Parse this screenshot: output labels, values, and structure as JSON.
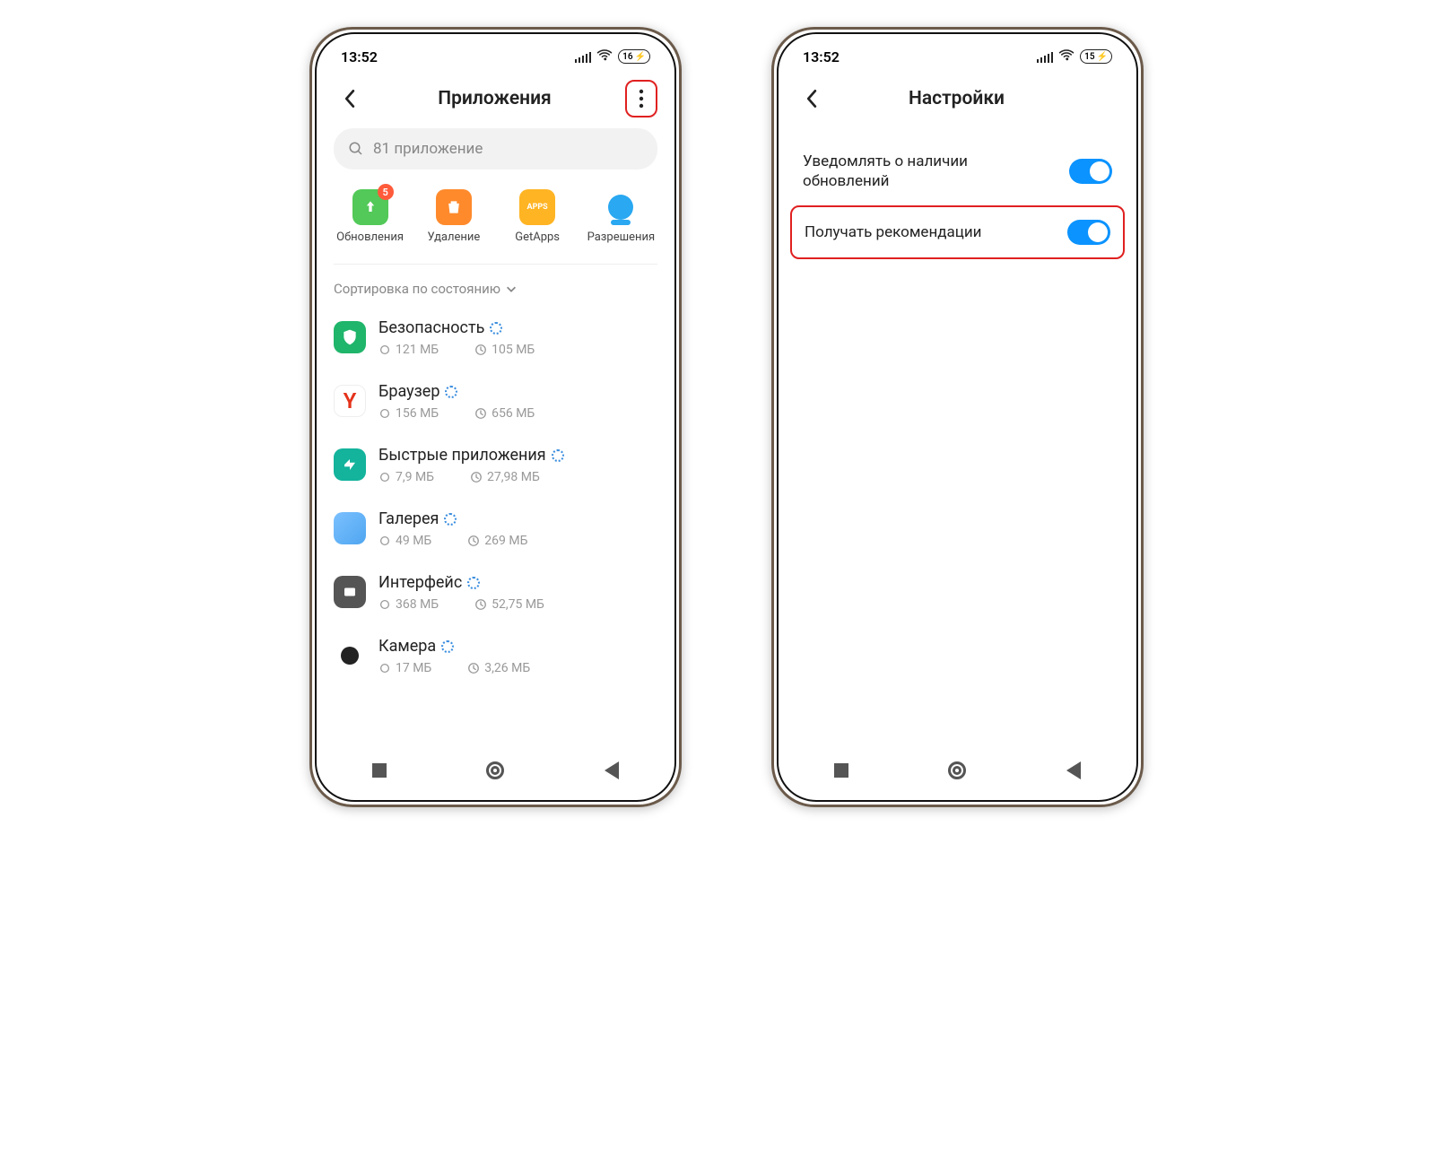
{
  "time": "13:52",
  "battery_left": "16",
  "battery_right": "15",
  "left": {
    "title": "Приложения",
    "search_placeholder": "81 приложение",
    "grid": [
      {
        "label": "Обновления",
        "badge": "5"
      },
      {
        "label": "Удаление"
      },
      {
        "label": "GetApps"
      },
      {
        "label": "Разрешения"
      }
    ],
    "sort_label": "Сортировка по состоянию",
    "apps": [
      {
        "name": "Безопасность",
        "storage": "121 МБ",
        "data": "105 МБ"
      },
      {
        "name": "Браузер",
        "storage": "156 МБ",
        "data": "656 МБ"
      },
      {
        "name": "Быстрые приложения",
        "storage": "7,9 МБ",
        "data": "27,98 МБ"
      },
      {
        "name": "Галерея",
        "storage": "49 МБ",
        "data": "269 МБ"
      },
      {
        "name": "Интерфейс",
        "storage": "368 МБ",
        "data": "52,75 МБ"
      },
      {
        "name": "Камера",
        "storage": "17 МБ",
        "data": "3,26 МБ"
      }
    ]
  },
  "right": {
    "title": "Настройки",
    "rows": [
      {
        "label": "Уведомлять о наличии обновлений",
        "on": true
      },
      {
        "label": "Получать рекомендации",
        "on": true
      }
    ]
  }
}
